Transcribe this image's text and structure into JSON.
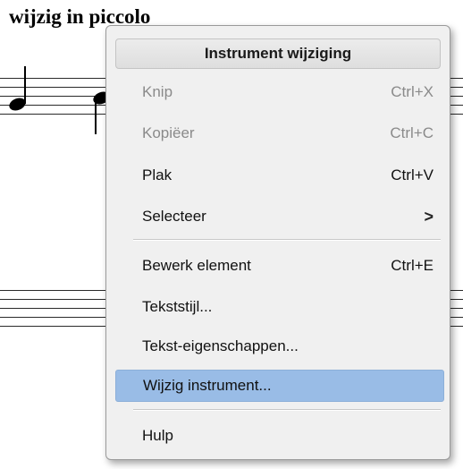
{
  "score": {
    "title": "wijzig in piccolo"
  },
  "context_menu": {
    "header": "Instrument wijziging",
    "items": [
      {
        "label": "Knip",
        "shortcut": "Ctrl+X",
        "enabled": false
      },
      {
        "label": "Kopiëer",
        "shortcut": "Ctrl+C",
        "enabled": false
      },
      {
        "label": "Plak",
        "shortcut": "Ctrl+V",
        "enabled": true
      },
      {
        "label": "Selecteer",
        "submenu_icon": "chevron-right-icon",
        "submenu_glyph": ">",
        "enabled": true
      },
      {
        "label": "Bewerk element",
        "shortcut": "Ctrl+E",
        "enabled": true
      },
      {
        "label": "Tekststijl...",
        "enabled": true
      },
      {
        "label": "Tekst-eigenschappen...",
        "enabled": true
      },
      {
        "label": "Wijzig instrument...",
        "enabled": true,
        "highlighted": true
      },
      {
        "label": "Hulp",
        "enabled": true
      }
    ]
  },
  "colors": {
    "highlight": "#99bce6",
    "disabled_text": "#8a8a8a",
    "menu_background": "#f0f0f0"
  }
}
